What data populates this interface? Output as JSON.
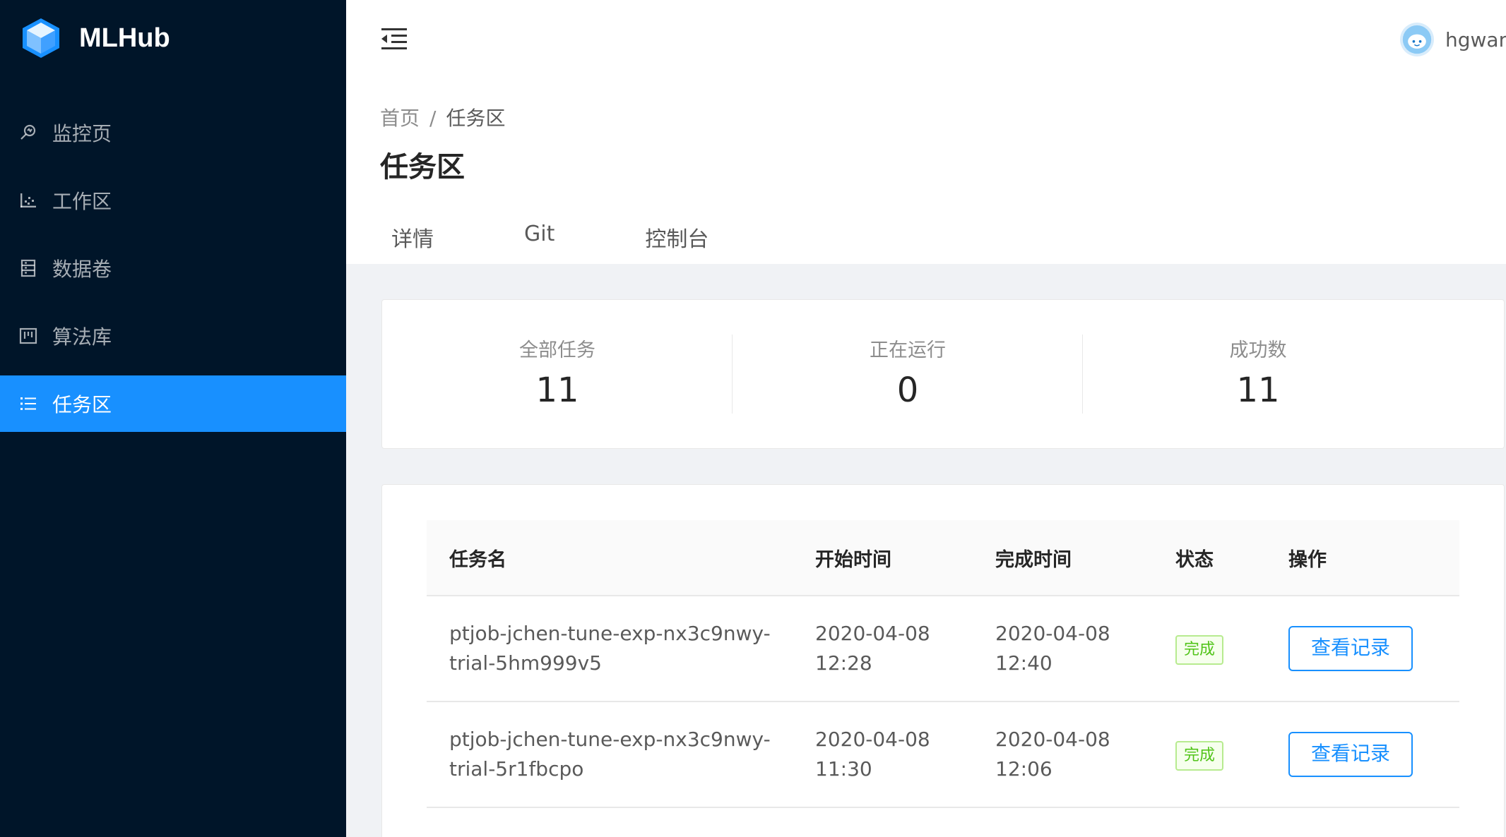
{
  "app": {
    "name": "MLHub"
  },
  "sidebar": {
    "items": [
      {
        "label": "监控页",
        "icon": "monitor-search-icon",
        "active": false
      },
      {
        "label": "工作区",
        "icon": "chart-scatter-icon",
        "active": false
      },
      {
        "label": "数据卷",
        "icon": "database-icon",
        "active": false
      },
      {
        "label": "算法库",
        "icon": "project-board-icon",
        "active": false
      },
      {
        "label": "任务区",
        "icon": "list-icon",
        "active": true
      }
    ]
  },
  "header": {
    "username": "hgwan"
  },
  "breadcrumb": {
    "home": "首页",
    "separator": "/",
    "current": "任务区"
  },
  "page": {
    "title": "任务区"
  },
  "tabs": [
    "详情",
    "Git",
    "控制台"
  ],
  "stats": [
    {
      "label": "全部任务",
      "value": "11"
    },
    {
      "label": "正在运行",
      "value": "0"
    },
    {
      "label": "成功数",
      "value": "11"
    }
  ],
  "table": {
    "columns": [
      "任务名",
      "开始时间",
      "完成时间",
      "状态",
      "操作"
    ],
    "rows": [
      {
        "name": "ptjob-jchen-tune-exp-nx3c9nwy-trial-5hm999v5",
        "start": "2020-04-08 12:28",
        "end": "2020-04-08 12:40",
        "status": "完成",
        "action": "查看记录"
      },
      {
        "name": "ptjob-jchen-tune-exp-nx3c9nwy-trial-5r1fbcpo",
        "start": "2020-04-08 11:30",
        "end": "2020-04-08 12:06",
        "status": "完成",
        "action": "查看记录"
      }
    ]
  },
  "colors": {
    "sidebar_bg": "#001529",
    "primary": "#1890ff",
    "success": "#52c41a"
  }
}
